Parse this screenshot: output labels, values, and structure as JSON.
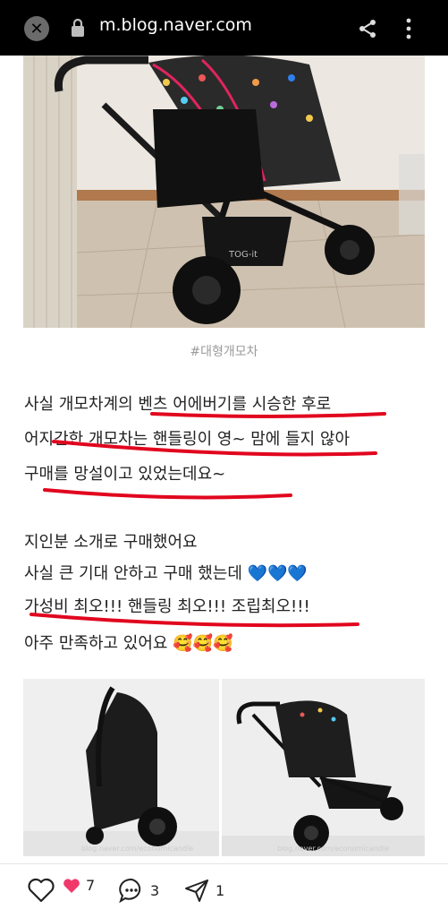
{
  "browser": {
    "url": "m.blog.naver.com",
    "close_icon": "close-icon",
    "lock_icon": "lock-icon",
    "share_icon": "share-icon",
    "menu_icon": "more-vert-icon"
  },
  "post": {
    "caption": "#대형개모차",
    "paragraph1": [
      "사실 개모차계의 벤츠 어에버기를 시승한 후로",
      "어지간한 개모차는 핸들링이 영~ 맘에 들지 않아",
      "구매를 망설이고 있었는데요~"
    ],
    "paragraph2": [
      "지인분 소개로 구매했어요",
      "사실 큰 기대 안하고 구매 했는데 💙💙💙",
      "가성비 최오!!! 핸들링 최오!!! 조립최오!!!",
      "아주 만족하고 있어요 🥰🥰🥰"
    ],
    "watermark_left": "blog.naver.com/economicandle",
    "watermark_right": "blog.naver.com/economicandle",
    "stroller_label": "TOG-it"
  },
  "actions": {
    "like_icon": "heart-outline-icon",
    "likes_icon": "heart-filled-icon",
    "likes_count": "7",
    "comment_icon": "comment-icon",
    "comments_count": "3",
    "share_icon": "send-icon",
    "shares_count": "1"
  },
  "colors": {
    "underline": "#e1061e",
    "heart": "#f0386b"
  }
}
